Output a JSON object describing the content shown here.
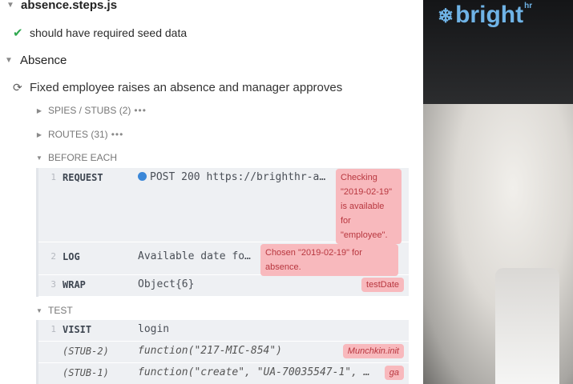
{
  "spec_file": "absence.steps.js",
  "passed_test": "should have required seed data",
  "suite": "Absence",
  "test_title": "Fixed employee raises an absence and manager approves",
  "sections": {
    "spies": "SPIES / STUBS (2)",
    "routes": "ROUTES (31)",
    "before_each": "BEFORE EACH",
    "test": "TEST",
    "more": "•••"
  },
  "before_each_commands": [
    {
      "num": "1",
      "name": "REQUEST",
      "msg": "POST 200 https://brighthr-a…",
      "note": "Checking \"2019-02-19\" is available for \"employee\"."
    },
    {
      "num": "2",
      "name": "LOG",
      "msg": "Available date fo…",
      "note": "Chosen \"2019-02-19\" for absence."
    },
    {
      "num": "3",
      "name": "WRAP",
      "msg": "Object{6}",
      "note": "testDate"
    }
  ],
  "test_commands": [
    {
      "num": "1",
      "name": "VISIT",
      "msg": "login",
      "note": ""
    },
    {
      "num": "",
      "name": "(STUB-2)",
      "msg": "function(\"217-MIC-854\")",
      "note": "Munchkin.init"
    },
    {
      "num": "",
      "name": "(STUB-1)",
      "msg": "function(\"create\", \"UA-70035547-1\", …",
      "note": "ga"
    }
  ],
  "brand": {
    "logo_text": "bright",
    "logo_sup": "hr",
    "logo_mark": "❄",
    "color": "#6fb3e6"
  },
  "colors": {
    "pass": "#2fa84f",
    "request_dot": "#3b87d8",
    "note_bg": "#f8b9bd",
    "note_text": "#b8373f"
  }
}
